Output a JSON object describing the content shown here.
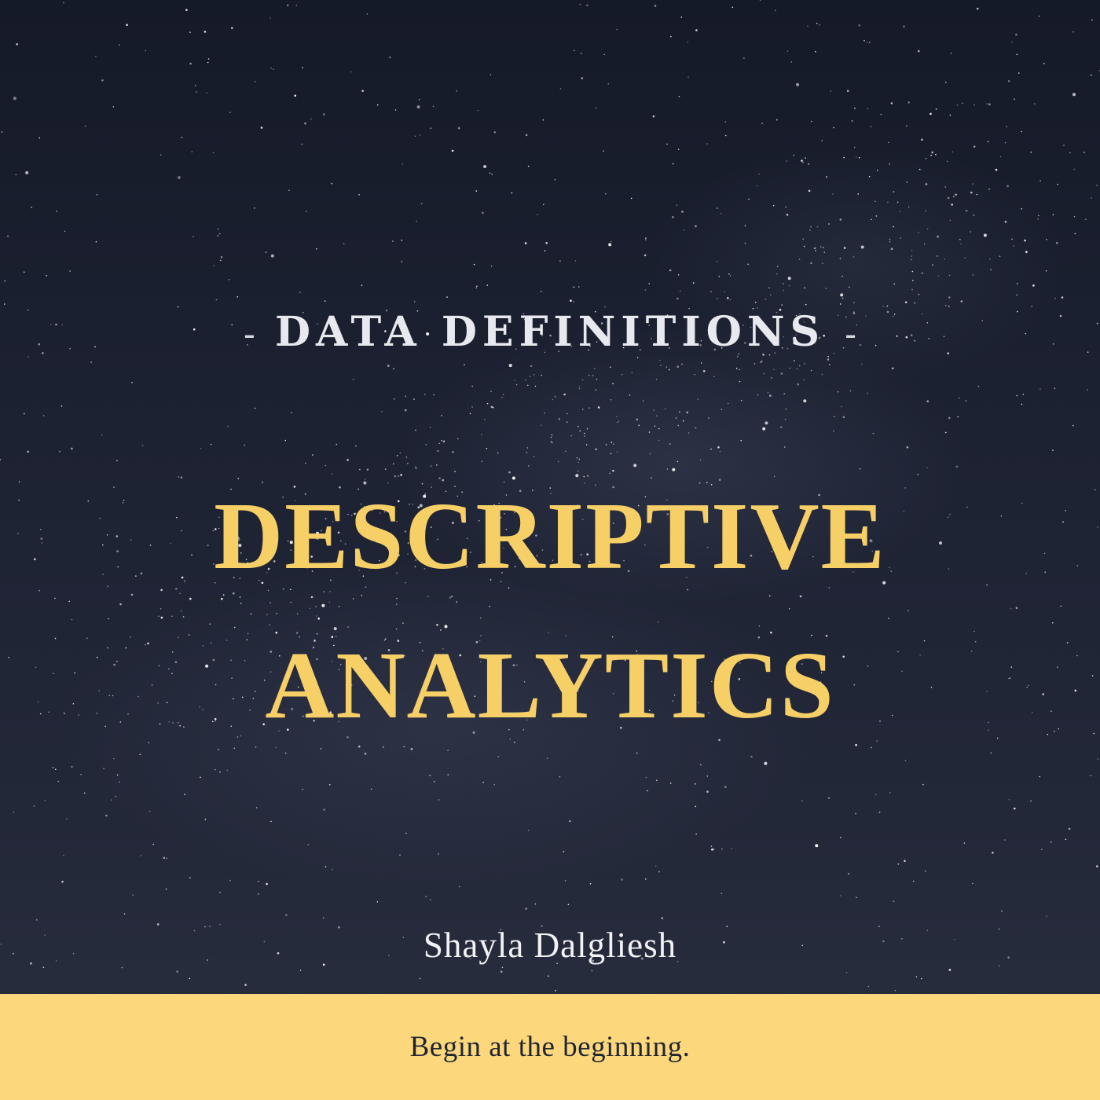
{
  "cover": {
    "kicker": "DATA DEFINITIONS",
    "kicker_dash": "-",
    "title_line_1": "DESCRIPTIVE",
    "title_line_2": "ANALYTICS",
    "author": "Shayla Dalgliesh",
    "tagline": "Begin at the beginning."
  },
  "colors": {
    "background": "#1d2232",
    "title": "#f7cf67",
    "kicker": "#e8e9ee",
    "author": "#f2f2f5",
    "tagline_bar": "#fdd77b",
    "tagline_text": "#1f2533"
  }
}
